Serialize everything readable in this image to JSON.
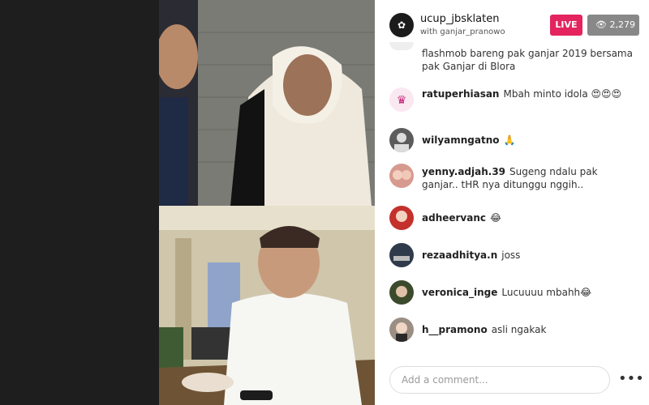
{
  "header": {
    "host_name": "ucup_jbsklaten",
    "with_text": "with ganjar_pranowo",
    "live_label": "LIVE",
    "viewer_count": "2,279"
  },
  "comments": [
    {
      "user": "",
      "text": "flashmob bareng pak ganjar 2019 bersama pak Ganjar di Blora"
    },
    {
      "user": "ratuperhiasan",
      "text": "Mbah minto idola 😍😍😍"
    },
    {
      "user": "wilyamngatno",
      "text": "🙏"
    },
    {
      "user": "yenny.adjah.39",
      "text": "Sugeng ndalu pak ganjar.. tHR nya ditunggu nggih.."
    },
    {
      "user": "adheervanc",
      "text": "😂"
    },
    {
      "user": "rezaadhitya.n",
      "text": "joss"
    },
    {
      "user": "veronica_inge",
      "text": "Lucuuuu mbahh😂"
    },
    {
      "user": "h__pramono",
      "text": "asli ngakak"
    }
  ],
  "input": {
    "placeholder": "Add a comment..."
  },
  "more_label": "•••",
  "colors": {
    "live": "#e3245e",
    "viewer_badge": "#888888",
    "panel_bg": "#ffffff"
  }
}
